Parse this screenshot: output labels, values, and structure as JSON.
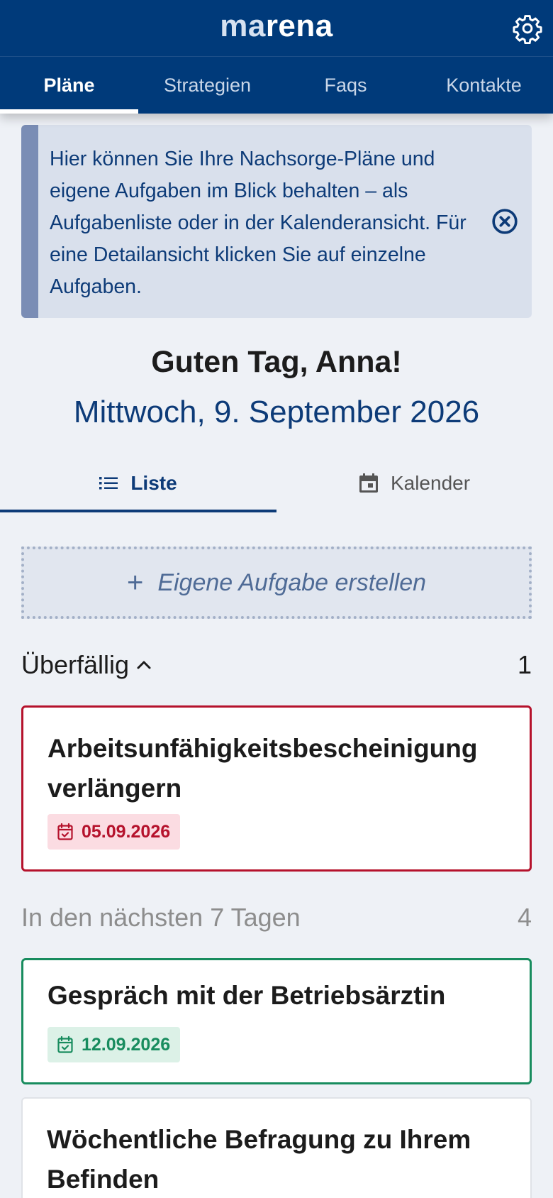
{
  "app": {
    "brand_part1": "ma",
    "brand_part2": "rena",
    "settings_icon": "gear-icon"
  },
  "nav": {
    "tabs": [
      {
        "label": "Pläne",
        "active": true
      },
      {
        "label": "Strategien",
        "active": false
      },
      {
        "label": "Faqs",
        "active": false
      },
      {
        "label": "Kontakte",
        "active": false
      }
    ]
  },
  "info": {
    "text": "Hier können Sie Ihre Nachsorge-Pläne und eigene Aufgaben im Blick behalten – als Aufgabenliste oder in der Kalenderansicht. Für eine Detailansicht klicken Sie auf einzelne Aufgaben.",
    "close_icon": "close-circle-icon"
  },
  "greeting": "Guten Tag, Anna!",
  "date": "Mittwoch, 9. September 2026",
  "view_tabs": {
    "list_label": "Liste",
    "calendar_label": "Kalender",
    "active": "list"
  },
  "add_task": {
    "plus": "+",
    "label": "Eigene Aufgabe erstellen"
  },
  "sections": {
    "overdue": {
      "title": "Überfällig",
      "count": "1"
    },
    "upcoming": {
      "title": "In den nächsten 7 Tagen",
      "count": "4"
    }
  },
  "tasks": [
    {
      "title": "Arbeitsunfähigkeitsbescheinigung verlängern",
      "due": "05.09.2026",
      "status_color": "#b5122c"
    },
    {
      "title": "Gespräch mit der Betriebsärztin",
      "due": "12.09.2026",
      "status_color": "#188c5e"
    },
    {
      "title": "Wöchentliche Befragung zu Ihrem Befinden"
    }
  ],
  "colors": {
    "header": "#003a7a",
    "accent": "#0d3b78",
    "overdue": "#b5122c",
    "soon": "#188c5e"
  }
}
